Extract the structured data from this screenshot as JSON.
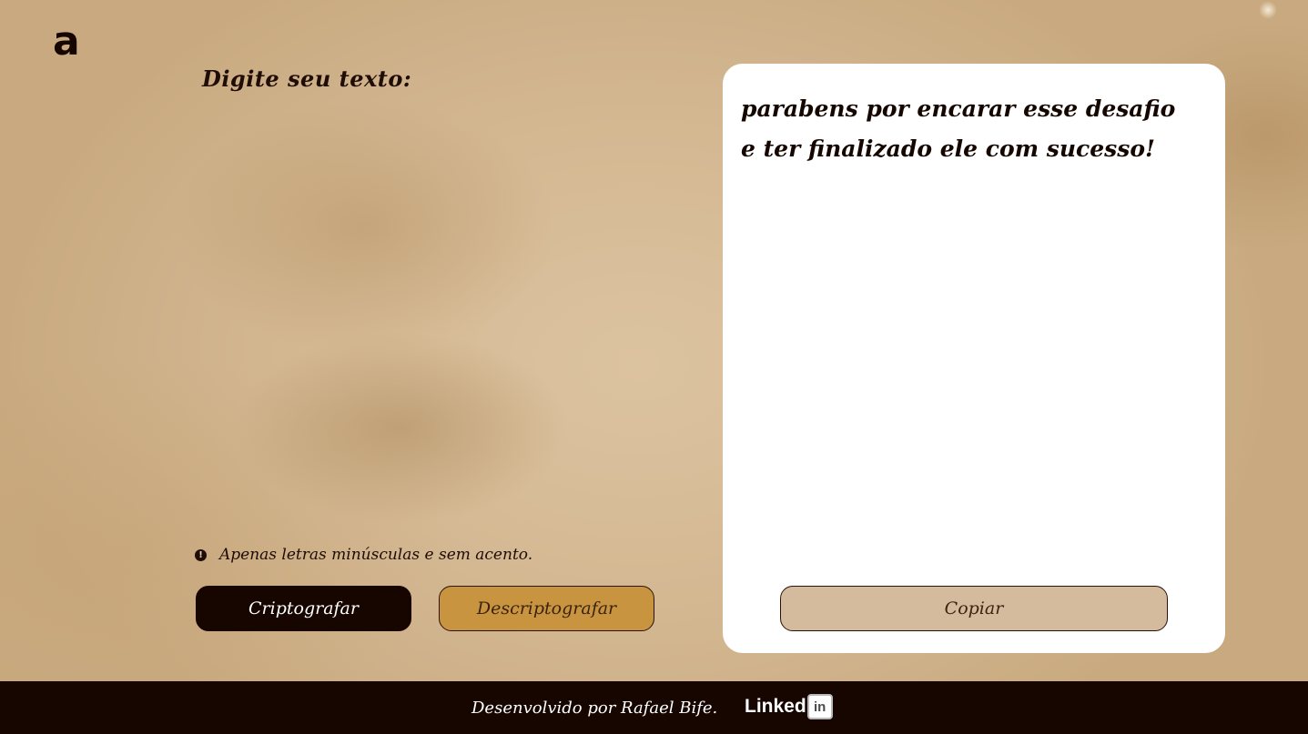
{
  "logo": {
    "glyph": "a"
  },
  "input": {
    "label": "Digite seu texto:",
    "value": ""
  },
  "notice": {
    "icon": "exclamation-circle-icon",
    "glyph": "!",
    "text": "Apenas letras minúsculas e sem acento."
  },
  "buttons": {
    "encrypt": "Criptografar",
    "decrypt": "Descriptografar",
    "copy": "Copiar"
  },
  "output": {
    "text": "parabens por encarar esse desafio e ter finalizado ele com sucesso!"
  },
  "footer": {
    "credit": "Desenvolvido por Rafael Bife.",
    "linkedin_word": "Linked",
    "linkedin_badge": "in"
  },
  "colors": {
    "dark_brown": "#170500",
    "gold": "#c9943f",
    "tan": "#d5bb9e",
    "card": "#ffffff"
  }
}
